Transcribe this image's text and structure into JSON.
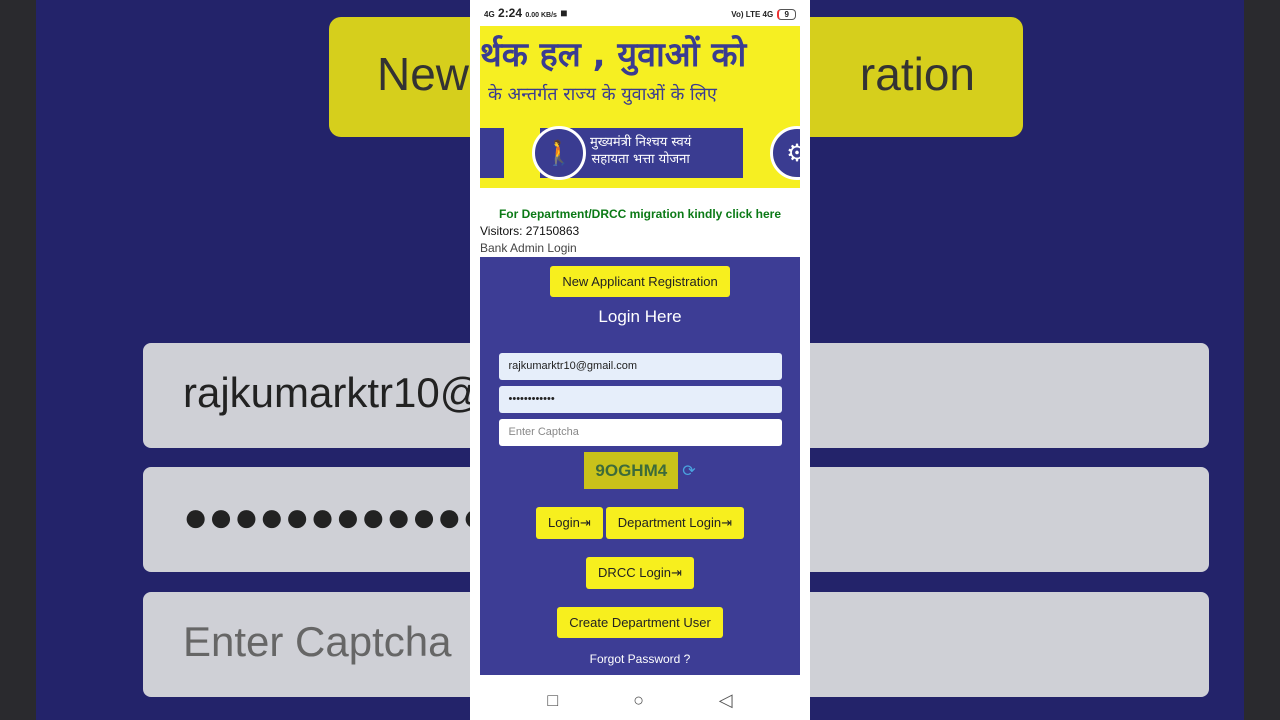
{
  "background": {
    "box_left": "New A",
    "box_right": "ration",
    "email": "rajkumarktr10@",
    "password": "●●●●●●●●●●●●",
    "captcha": "Enter Captcha"
  },
  "status": {
    "network": "4G",
    "time": "2:24",
    "speed": "0.00 KB/s",
    "right": "Vo) LTE 4G",
    "battery": "9"
  },
  "banner": {
    "line1": "र्थक हल , युवाओं को",
    "line2": "के अन्तर्गत राज्य के युवाओं के लिए",
    "scheme_line1": "मुख्यमंत्री निश्चय स्वयं",
    "scheme_line2": "सहायता भत्ता योजना"
  },
  "migration_link": "For Department/DRCC migration kindly click here",
  "visitors": "Visitors: 27150863",
  "bank_admin_login": "Bank Admin Login",
  "panel": {
    "register": "New Applicant Registration",
    "title": "Login Here",
    "email": "rajkumarktr10@gmail.com",
    "password": "••••••••••••",
    "captcha_placeholder": "Enter Captcha",
    "captcha_text": "9OGHM4",
    "login": "Login",
    "dept_login": "Department Login",
    "drcc_login": "DRCC Login",
    "create_user": "Create Department User",
    "forgot": "Forgot Password ?"
  },
  "colors": {
    "panel": "#3d3d95",
    "button": "#f7ef1e",
    "link": "#0b7a16"
  }
}
